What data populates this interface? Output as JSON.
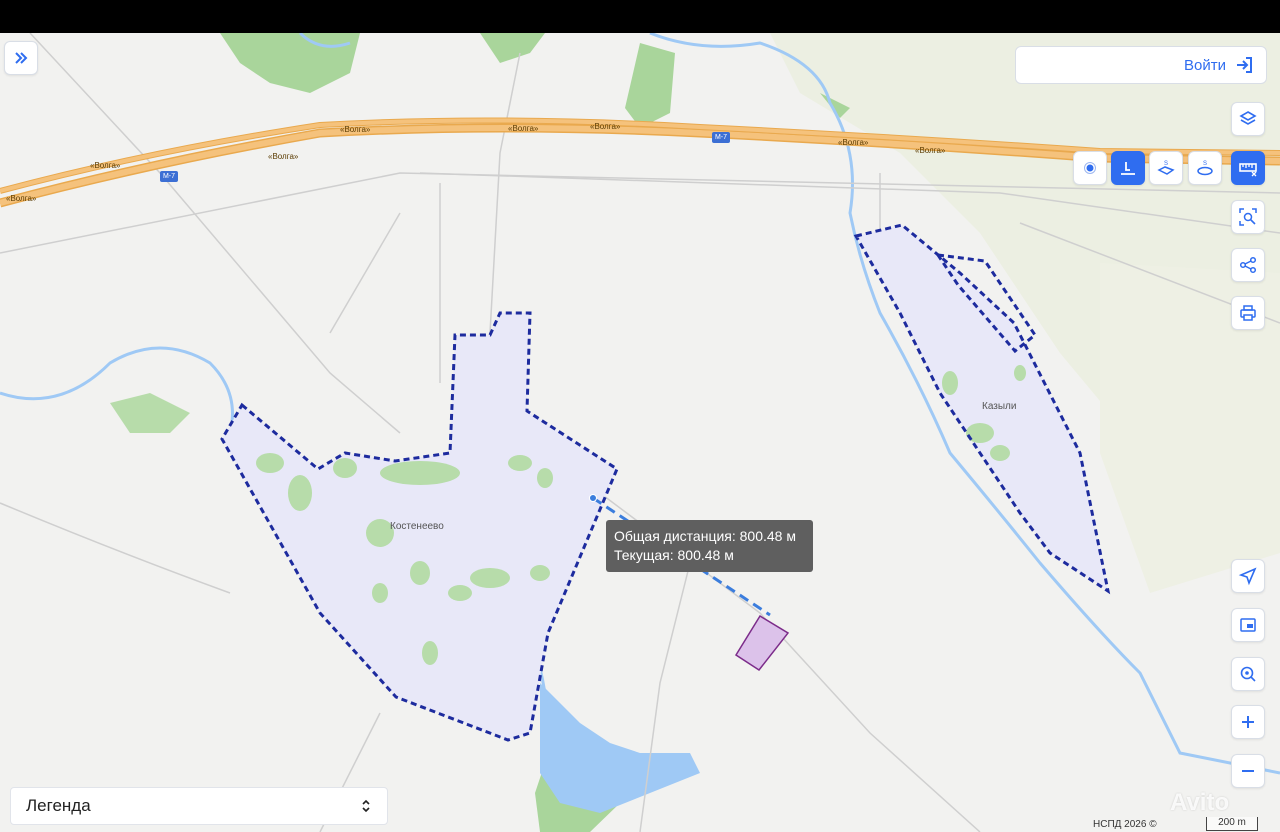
{
  "top": {
    "login_label": "Войти"
  },
  "map": {
    "road_labels": [
      "«Волга»",
      "«Волга»",
      "«Волга»",
      "«Волга»",
      "«Волга»",
      "«Волга»",
      "«Волга»",
      "«Волга»",
      "«Волга»"
    ],
    "road_shields": [
      "М-7",
      "М-7"
    ],
    "settlements": [
      "Костенеево",
      "Казыли"
    ]
  },
  "tooltip": {
    "total": "Общая дистанция: 800.48 м",
    "current": "Текущая: 800.48 м"
  },
  "legend": {
    "label": "Легенда"
  },
  "footer": {
    "copyright": "НСПД 2026 ©",
    "scale": "200 m"
  },
  "watermark": "Avito",
  "colors": {
    "accent": "#2f6df0",
    "boundary": "#1d2b9e",
    "highway": "#f0b35a",
    "water": "#9fc9f5",
    "forest": "#a9d59b"
  }
}
